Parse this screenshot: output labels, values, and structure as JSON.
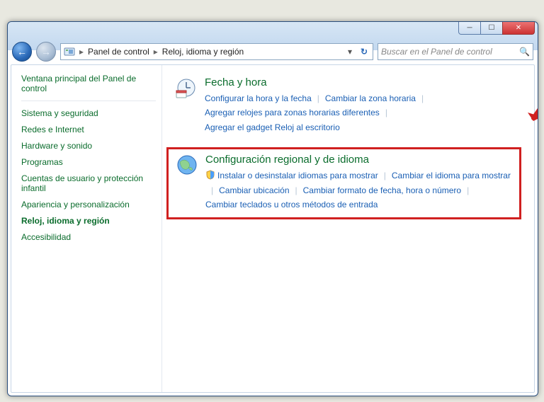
{
  "breadcrumb": {
    "root": "Panel de control",
    "current": "Reloj, idioma y región"
  },
  "search": {
    "placeholder": "Buscar en el Panel de control"
  },
  "sidebar": {
    "title": "Ventana principal del Panel de control",
    "items": [
      {
        "label": "Sistema y seguridad"
      },
      {
        "label": "Redes e Internet"
      },
      {
        "label": "Hardware y sonido"
      },
      {
        "label": "Programas"
      },
      {
        "label": "Cuentas de usuario y protección infantil"
      },
      {
        "label": "Apariencia y personalización"
      },
      {
        "label": "Reloj, idioma y región"
      },
      {
        "label": "Accesibilidad"
      }
    ]
  },
  "sections": [
    {
      "title": "Fecha y hora",
      "tasks": [
        "Configurar la hora y la fecha",
        "Cambiar la zona horaria",
        "Agregar relojes para zonas horarias diferentes",
        "Agregar el gadget Reloj al escritorio"
      ]
    },
    {
      "title": "Configuración regional y de idioma",
      "tasks": [
        "Instalar o desinstalar idiomas para mostrar",
        "Cambiar el idioma para mostrar",
        "Cambiar ubicación",
        "Cambiar formato de fecha, hora o número",
        "Cambiar teclados u otros métodos de entrada"
      ]
    }
  ]
}
